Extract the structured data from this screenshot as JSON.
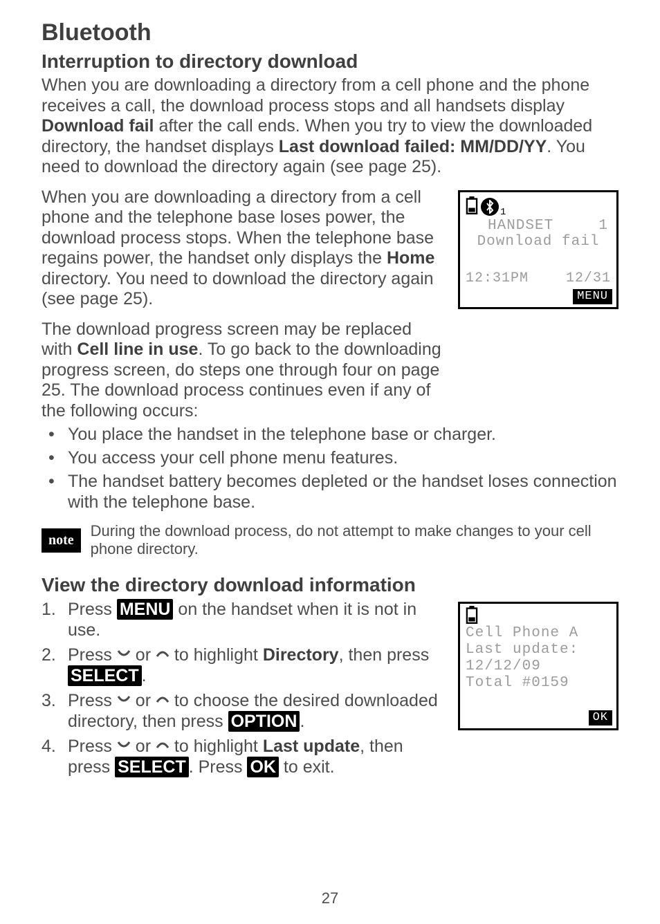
{
  "page_number": "27",
  "h1": "Bluetooth",
  "section1": {
    "heading": "Interruption to directory download",
    "p1_a": "When you are downloading a directory from a cell phone and the phone receives a call, the download process stops and all handsets display ",
    "p1_bold1": "Download fail",
    "p1_b": " after the call ends. When you try to view the downloaded directory, the handset displays ",
    "p1_bold2": "Last download failed: MM/DD/YY",
    "p1_c": ". You need to download the directory again (see page 25).",
    "p2_a": "When you are downloading a directory from a cell phone and the telephone base loses power, the download process stops. When the telephone base regains power, the handset only displays the ",
    "p2_bold": "Home",
    "p2_b": " directory. You need to download the directory again (see page 25).",
    "p3_a": "The download progress screen may be replaced with ",
    "p3_bold": "Cell line in use",
    "p3_b": ". To go back to the downloading progress screen, do steps one through four on page 25. The download process continues even if any of the following occurs:",
    "bullets": [
      "You place the handset in the telephone base or charger.",
      "You access your cell phone menu features.",
      "The handset battery becomes depleted or the handset loses connection with the telephone base."
    ]
  },
  "note": {
    "badge": "note",
    "text": "During the download process, do not attempt to make changes to your cell phone directory."
  },
  "section2": {
    "heading": "View the directory download information",
    "step1_a": "Press ",
    "btn_menu": "MENU",
    "step1_b": " on the handset when it is not in use.",
    "step2_a": "Press ",
    "step2_b": " or ",
    "step2_c": " to highlight ",
    "step2_bold": "Directory",
    "step2_d": ", then press ",
    "btn_select": "SELECT",
    "step2_e": ".",
    "step3_a": "Press ",
    "step3_b": " or ",
    "step3_c": " to choose the desired downloaded directory, then press ",
    "btn_option": "OPTION",
    "step3_d": ".",
    "step4_a": "Press ",
    "step4_b": " or ",
    "step4_c": " to highlight ",
    "step4_bold": "Last update",
    "step4_d": ", then press ",
    "step4_e": ". Press ",
    "btn_ok": "OK",
    "step4_f": " to exit."
  },
  "lcd1": {
    "bt_sub": "1",
    "handset_label": "HANDSET",
    "handset_num": "1",
    "status": "Download fail",
    "time": "12:31PM",
    "date": "12/31",
    "menu": "MENU"
  },
  "lcd2": {
    "l1": "Cell Phone A",
    "l2": "Last update:",
    "l3": "12/12/09",
    "l4": "Total #0159",
    "ok": "OK"
  }
}
